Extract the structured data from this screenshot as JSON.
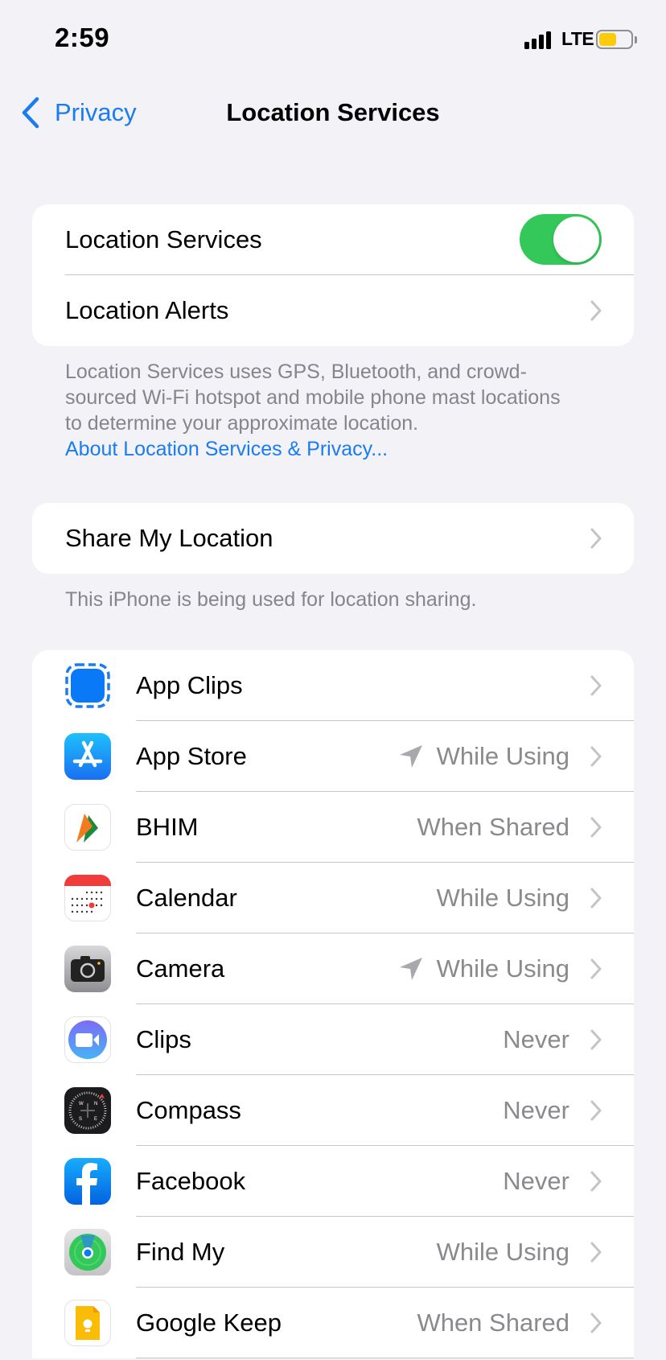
{
  "status_bar": {
    "time": "2:59",
    "network": "LTE",
    "signal_bars": 4,
    "battery_level": 0.55,
    "battery_color": "#fccb0b",
    "icons": [
      "signal-icon",
      "battery-icon"
    ]
  },
  "nav": {
    "back_label": "Privacy",
    "back_icon": "chevron-left-icon",
    "title": "Location Services",
    "accent_color": "#1a7cf0"
  },
  "main_section": {
    "location_services": {
      "label": "Location Services",
      "enabled": true,
      "toggle_color": "#34c759"
    },
    "location_alerts": {
      "label": "Location Alerts"
    },
    "footer_text": "Location Services uses GPS, Bluetooth, and crowd-sourced Wi-Fi hotspot and mobile phone mast locations to determine your approximate location.",
    "footer_link": "About Location Services & Privacy..."
  },
  "share_section": {
    "share_my_location": {
      "label": "Share My Location"
    },
    "footer_text": "This iPhone is being used for location sharing."
  },
  "apps": [
    {
      "name": "App Clips",
      "value": "",
      "recent_use": false,
      "icon": "app-clips-icon"
    },
    {
      "name": "App Store",
      "value": "While Using",
      "recent_use": true,
      "icon": "app-store-icon"
    },
    {
      "name": "BHIM",
      "value": "When Shared",
      "recent_use": false,
      "icon": "bhim-icon"
    },
    {
      "name": "Calendar",
      "value": "While Using",
      "recent_use": false,
      "icon": "calendar-icon"
    },
    {
      "name": "Camera",
      "value": "While Using",
      "recent_use": true,
      "icon": "camera-icon"
    },
    {
      "name": "Clips",
      "value": "Never",
      "recent_use": false,
      "icon": "clips-icon"
    },
    {
      "name": "Compass",
      "value": "Never",
      "recent_use": false,
      "icon": "compass-icon"
    },
    {
      "name": "Facebook",
      "value": "Never",
      "recent_use": false,
      "icon": "facebook-icon"
    },
    {
      "name": "Find My",
      "value": "While Using",
      "recent_use": false,
      "icon": "find-my-icon"
    },
    {
      "name": "Google Keep",
      "value": "When Shared",
      "recent_use": false,
      "icon": "google-keep-icon"
    }
  ]
}
